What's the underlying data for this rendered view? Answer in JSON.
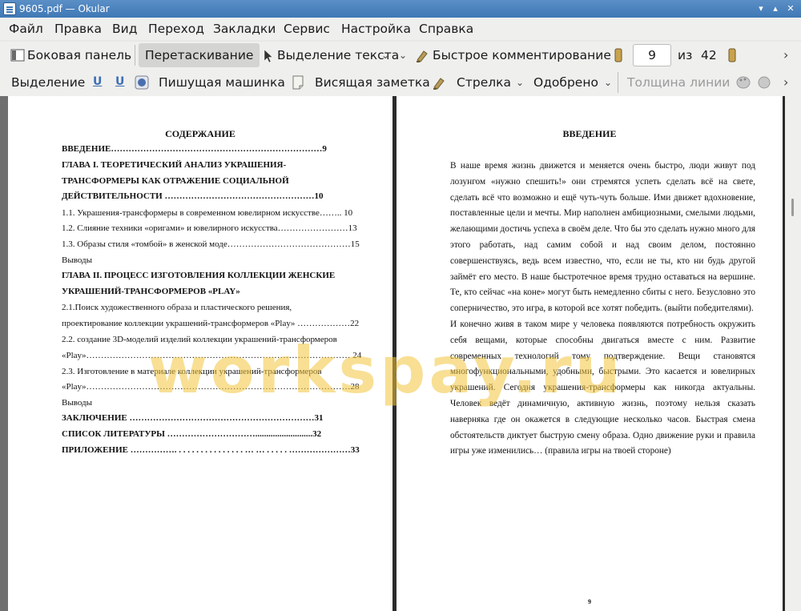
{
  "window": {
    "title": "9605.pdf  — Okular"
  },
  "menu": {
    "items": [
      "Файл",
      "Правка",
      "Вид",
      "Переход",
      "Закладки",
      "Сервис",
      "Настройка",
      "Справка"
    ]
  },
  "toolbar1": {
    "sidebar": "Боковая панель",
    "drag": "Перетаскивание",
    "text_select": "Выделение текста",
    "quick_comment": "Быстрое комментирование",
    "page_current": "9",
    "page_of": "из",
    "page_total": "42"
  },
  "toolbar2": {
    "selection": "Выделение",
    "typewriter": "Пишущая машинка",
    "popup_note": "Висящая заметка",
    "arrow": "Стрелка",
    "approved": "Одобрено",
    "line_width": "Толщина линии"
  },
  "left_page": {
    "title": "СОДЕРЖАНИЕ",
    "lines": [
      "ВВЕДЕНИЕ………………………………………………………………9",
      "ГЛАВА I. ТЕОРЕТИЧЕСКИЙ АНАЛИЗ УКРАШЕНИЯ-",
      "ТРАНСФОРМЕРЫ КАК ОТРАЖЕНИЕ СОЦИАЛЬНОЙ",
      "ДЕЙСТВИТЕЛЬНОСТИ ……………………………………………10",
      "1.1. Украшения-трансформеры в современном ювелирном искусстве…….. 10",
      "1.2. Слияние техники «оригами» и ювелирного искусства……………………13",
      "1.3. Образы стиля «томбой» в женской моде……………………………………15",
      "Выводы",
      "ГЛАВА II. ПРОЦЕСС ИЗГОТОВЛЕНИЯ КОЛЛЕКЦИИ ЖЕНСКИЕ",
      "УКРАШЕНИЙ-ТРАНСФОРМЕРОВ «PLAY»",
      "2.1.Поиск художественного образа и пластического решения,",
      "проектирование коллекции украшений-трансформеров «Play» ………………22",
      "2.2. создание 3D-моделий изделий коллекции украшений-трансформеров",
      "«Play»……………………………………………………………………………… 24",
      "2.3. Изготовление в материале коллекции украшений-трансформеров",
      "«Play»………………………………………………………………………………28",
      "Выводы",
      "ЗАКЛЮЧЕНИЕ ………………………………………………………31",
      "СПИСОК ЛИТЕРАТУРЫ …………………………..........................32",
      "ПРИЛОЖЕНИЕ ……………. . . . . . . . . . . . . . . . … … . . . . . …………………33"
    ]
  },
  "right_page": {
    "title": "ВВЕДЕНИЕ",
    "paragraph1": "В наше время жизнь движется и меняется очень быстро, люди живут под лозунгом «нужно спешить!» они стремятся успеть сделать всё на свете, сделать всё что возможно и ещё чуть-чуть больше. Ими движет вдохновение, поставленные цели и мечты. Мир наполнен амбициозными, смелыми людьми, желающими достичь успеха в своём деле. Что бы это сделать нужно много для этого работать, над самим собой и над своим делом, постоянно совершенствуясь, ведь всем известно, что, если не ты, кто ни будь другой займёт его место. В наше быстротечное время трудно оставаться на вершине. Те, кто сейчас «на коне» могут быть немедленно сбиты с него. Безусловно это соперничество, это игра, в которой все хотят победить. (выйти победителями).",
    "paragraph2": "И конечно живя в таком мире у человека появляются потребность окружить себя вещами, которые способны двигаться вместе с ним. Развитие современных технологий тому подтверждение. Вещи становятся многофункциональными, удобными, быстрыми. Это касается и ювелирных украшений. Сегодня украшения-трансформеры как никогда актуальны. Человек ведёт динамичную, активную жизнь, поэтому нельзя сказать наверняка где он окажется в следующие несколько часов. Быстрая смена обстоятельств диктует быструю смену образа. Одно движение руки и правила игры уже изменились… (правила игры на твоей стороне)",
    "page_number": "9"
  },
  "watermark": "workspay.ru",
  "colors": {
    "titlebar": "#4a83bf",
    "toolbar": "#efefee",
    "doc_background": "#2b2b2b",
    "watermark": "#f3c43c"
  }
}
